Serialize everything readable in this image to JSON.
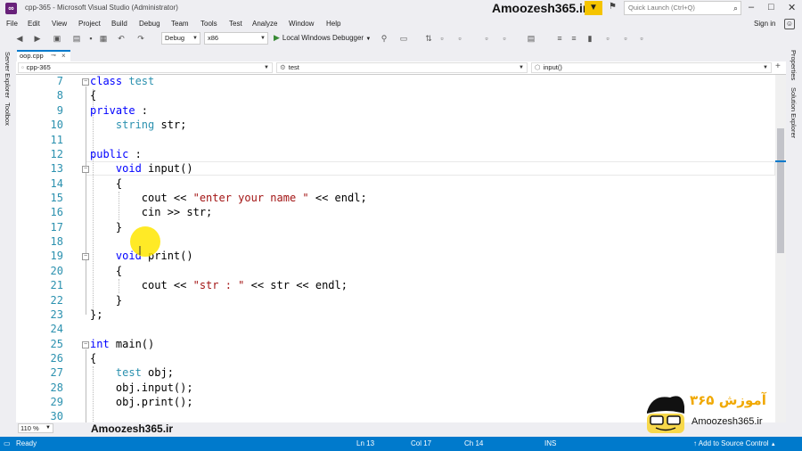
{
  "window": {
    "title": "cpp-365 - Microsoft Visual Studio (Administrator)",
    "watermark": "Amoozesh365.ir",
    "quick_launch_placeholder": "Quick Launch (Ctrl+Q)"
  },
  "menu": [
    "File",
    "Edit",
    "View",
    "Project",
    "Build",
    "Debug",
    "Team",
    "Tools",
    "Test",
    "Analyze",
    "Window",
    "Help"
  ],
  "signin": "Sign in",
  "toolbar": {
    "configuration": "Debug",
    "platform": "x86",
    "run_label": "Local Windows Debugger"
  },
  "side_tabs": {
    "left": [
      "Server Explorer",
      "Toolbox"
    ],
    "right": [
      "Properties",
      "Solution Explorer"
    ]
  },
  "doc_tab": {
    "name": "oop.cpp",
    "pin": "⊸",
    "close": "×"
  },
  "nav": {
    "project": "cpp-365",
    "scope": "test",
    "member": "input()"
  },
  "code": {
    "line_numbers": [
      "7",
      "8",
      "9",
      "10",
      "11",
      "12",
      "13",
      "14",
      "15",
      "16",
      "17",
      "18",
      "19",
      "20",
      "21",
      "22",
      "23",
      "24",
      "25",
      "26",
      "27",
      "28",
      "29",
      "30"
    ]
  },
  "zoom": "110 %",
  "bottom_watermark": "Amoozesh365.ir",
  "status": {
    "ready": "Ready",
    "ln": "Ln 13",
    "col": "Col 17",
    "ch": "Ch 14",
    "ins": "INS",
    "source_control": "Add to Source Control"
  },
  "logo": {
    "persian": "آموزش ۳۶۵",
    "site": "Amoozesh365.ir"
  },
  "colors": {
    "accent": "#007acc",
    "keyword": "#0000ff",
    "type": "#2b91af",
    "string": "#a31515",
    "highlight": "#ffe600"
  }
}
